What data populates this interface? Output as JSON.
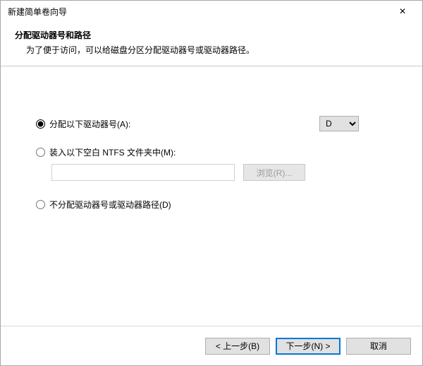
{
  "window": {
    "title": "新建简单卷向导",
    "close_glyph": "✕"
  },
  "header": {
    "title": "分配驱动器号和路径",
    "subtitle": "为了便于访问，可以给磁盘分区分配驱动器号或驱动器路径。"
  },
  "options": {
    "assign_letter_label": "分配以下驱动器号(A):",
    "mount_folder_label": "装入以下空白 NTFS 文件夹中(M):",
    "no_assign_label": "不分配驱动器号或驱动器路径(D)",
    "selected": "assign",
    "drive_letter": "D",
    "folder_path": "",
    "browse_label": "浏览(R)..."
  },
  "footer": {
    "back_label": "< 上一步(B)",
    "next_label": "下一步(N) >",
    "cancel_label": "取消"
  }
}
